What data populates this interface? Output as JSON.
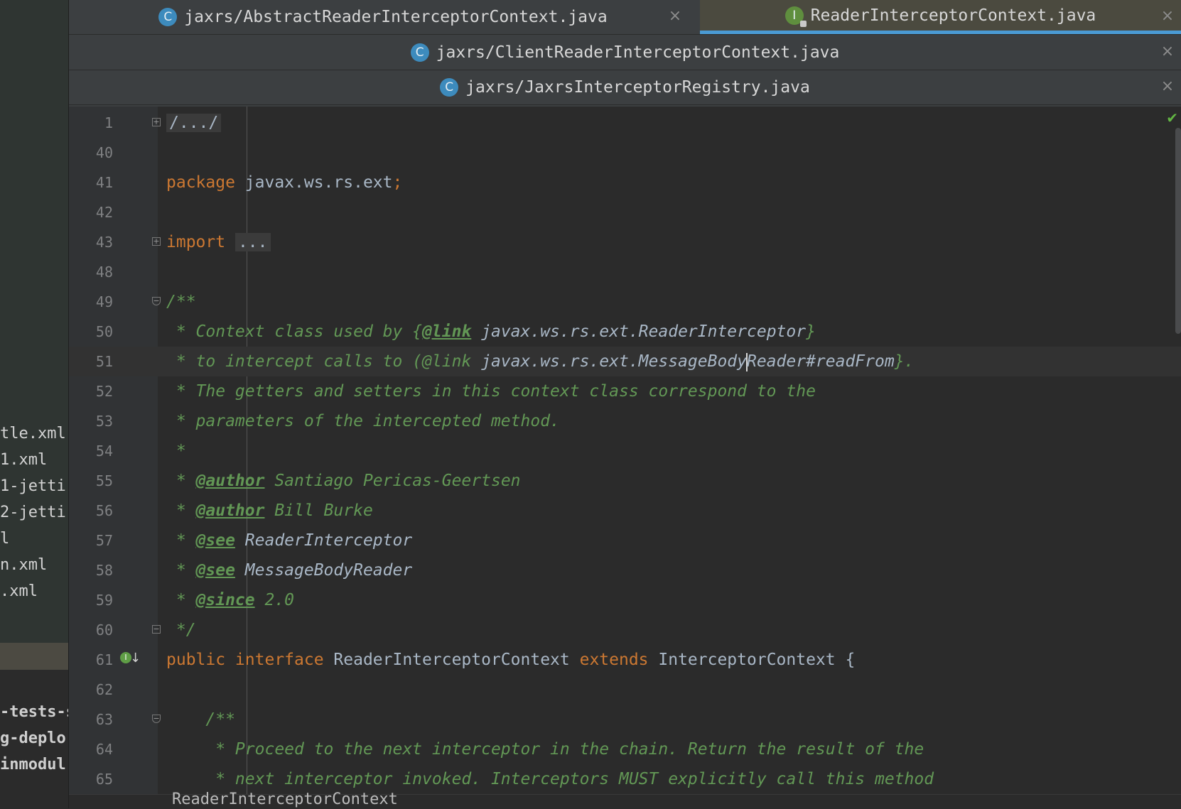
{
  "sidebar": {
    "items": [
      "tle.xml",
      "1.xml",
      "1-jetti",
      "2-jetti",
      "l",
      "n.xml",
      ".xml"
    ],
    "modules": [
      "-tests-s",
      "g-deplo",
      "inmodul"
    ]
  },
  "tabs": {
    "row1": [
      {
        "label": "jaxrs/AbstractReaderInterceptorContext.java",
        "icon": "C",
        "icon_type": "class-icon"
      },
      {
        "label": "ReaderInterceptorContext.java",
        "icon": "I",
        "icon_type": "interface-icon",
        "active": true
      }
    ],
    "row2": [
      {
        "label": "jaxrs/ClientReaderInterceptorContext.java",
        "icon": "C"
      }
    ],
    "row3": [
      {
        "label": "jaxrs/JaxrsInterceptorRegistry.java",
        "icon": "C"
      }
    ],
    "close_glyph": "×"
  },
  "editor": {
    "lines": [
      {
        "n": "1"
      },
      {
        "n": "40"
      },
      {
        "n": "41"
      },
      {
        "n": "42"
      },
      {
        "n": "43"
      },
      {
        "n": "48"
      },
      {
        "n": "49"
      },
      {
        "n": "50"
      },
      {
        "n": "51"
      },
      {
        "n": "52"
      },
      {
        "n": "53"
      },
      {
        "n": "54"
      },
      {
        "n": "55"
      },
      {
        "n": "56"
      },
      {
        "n": "57"
      },
      {
        "n": "58"
      },
      {
        "n": "59"
      },
      {
        "n": "60"
      },
      {
        "n": "61"
      },
      {
        "n": "62"
      },
      {
        "n": "63"
      },
      {
        "n": "64"
      },
      {
        "n": "65"
      }
    ],
    "code": {
      "l1": "/.../",
      "l41_kw": "package",
      "l41_rest": " javax.ws.rs.ext",
      "l41_semi": ";",
      "l43_kw": "import",
      "l43_folded": "...",
      "l49": "/**",
      "l50_a": " * Context class used by {",
      "l50_tag": "@link",
      "l50_ref": " javax.ws.rs.ext.ReaderInterceptor",
      "l50_b": "}",
      "l51_a": " * to intercept calls to (@link ",
      "l51_ref_a": "javax.ws.rs.ext.MessageBody",
      "l51_ref_b": "Reader#readFrom",
      "l51_b": "}.",
      "l52": " * The getters and setters in this context class correspond to the",
      "l53": " * parameters of the intercepted method.",
      "l54": " *",
      "l55_a": " * ",
      "l55_tag": "@author",
      "l55_b": " Santiago Pericas-Geertsen",
      "l56_a": " * ",
      "l56_tag": "@author",
      "l56_b": " Bill Burke",
      "l57_a": " * ",
      "l57_tag": "@see",
      "l57_ref": " ReaderInterceptor",
      "l58_a": " * ",
      "l58_tag": "@see",
      "l58_ref": " MessageBodyReader",
      "l59_a": " * ",
      "l59_tag": "@since",
      "l59_b": " 2.0",
      "l60": " */",
      "l61_kw1": "public interface",
      "l61_name": " ReaderInterceptorContext ",
      "l61_kw2": "extends",
      "l61_rest": " InterceptorContext {",
      "l63": "    /**",
      "l64": "     * Proceed to the next interceptor in the chain. Return the result of the",
      "l65": "     * next interceptor invoked. Interceptors MUST explicitly call this method"
    },
    "impl_marker": "I",
    "impl_arrow": "↓"
  },
  "breadcrumb": "ReaderInterceptorContext",
  "colors": {
    "keyword": "#cc7832",
    "plain": "#a9b7c6",
    "comment": "#629755",
    "active_tab_underline": "#4a9ad4"
  }
}
